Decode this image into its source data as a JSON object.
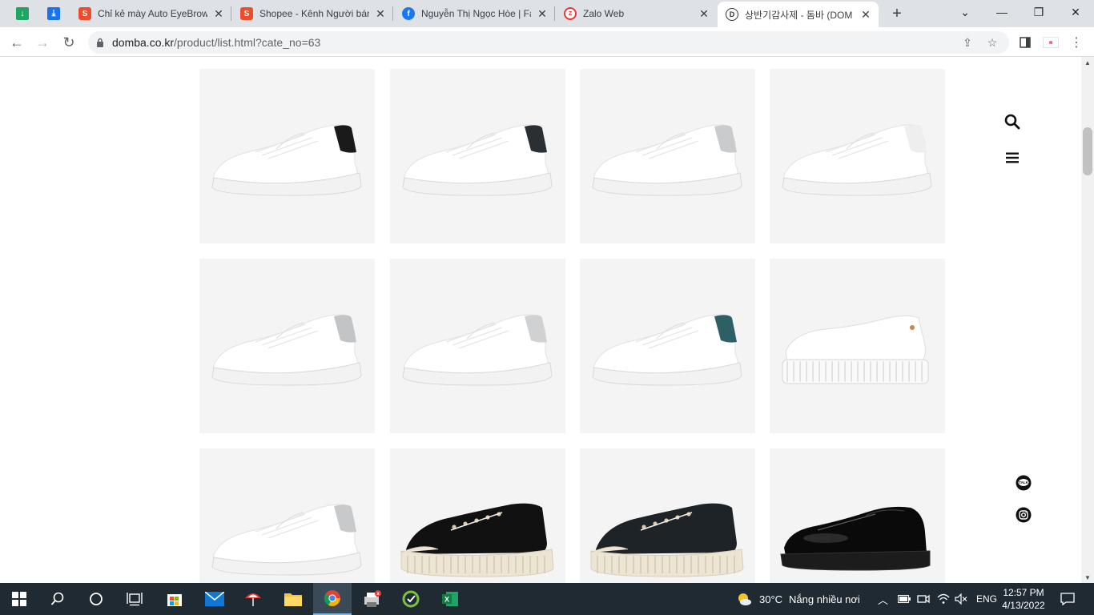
{
  "browser": {
    "tabs": [
      {
        "title": "Chỉ kẻ mày Auto EyeBrow",
        "favicon": "shopee-icon",
        "color": "#ee4d2d"
      },
      {
        "title": "Shopee - Kênh Người bán",
        "favicon": "shopee-icon",
        "color": "#ee4d2d"
      },
      {
        "title": "Nguyễn Thị Ngọc Hòe | Fa",
        "favicon": "facebook-icon",
        "color": "#1877f2"
      },
      {
        "title": "Zalo Web",
        "favicon": "zalo-icon",
        "color": "#e53935"
      },
      {
        "title": "상반기감사제 - 돔바 (DOM",
        "favicon": "domba-icon",
        "color": "#333333"
      }
    ],
    "url_host": "domba.co.kr",
    "url_path": "/product/list.html?cate_no=63"
  },
  "page": {
    "products": [
      {
        "style": "white",
        "accent": "#1a1a1a"
      },
      {
        "style": "white",
        "accent": "#2a2f33"
      },
      {
        "style": "white",
        "accent": "#c9cbcd"
      },
      {
        "style": "white",
        "accent": "#eeeeee"
      },
      {
        "style": "white",
        "accent": "#c2c4c6"
      },
      {
        "style": "white",
        "accent": "#d0d1d3"
      },
      {
        "style": "white",
        "accent": "#2f5f66"
      },
      {
        "style": "ribbed",
        "accent": "#ffffff"
      },
      {
        "style": "white",
        "accent": "#c8c9cb"
      },
      {
        "style": "canvas",
        "accent": "#111111"
      },
      {
        "style": "canvas",
        "accent": "#1d2326"
      },
      {
        "style": "derby",
        "accent": "#0a0a0a"
      }
    ]
  },
  "taskbar": {
    "weather_temp": "30°C",
    "weather_text": "Nắng nhiều nơi",
    "lang": "ENG",
    "time": "12:57 PM",
    "date": "4/13/2022"
  }
}
